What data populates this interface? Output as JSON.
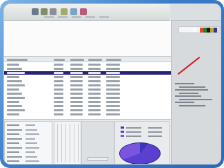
{
  "window": {
    "accent": "#2c68b8",
    "selection_color": "#26237a"
  },
  "toolbar": {
    "icons": [
      "open-icon",
      "save-icon",
      "print-icon",
      "cut-icon",
      "palette-icon",
      "photo-icon"
    ]
  },
  "pie_chart": {
    "colors": [
      "#3a34b8",
      "#5b3fd0",
      "#7a55e0"
    ]
  },
  "color_strip": {
    "swatches": [
      "#ffffff",
      "#f2f2f2",
      "#e04a2a",
      "#2e7a2a",
      "#1a1a1a",
      "#c8a21e",
      "#2a38a0",
      "#d9d9d9"
    ]
  }
}
